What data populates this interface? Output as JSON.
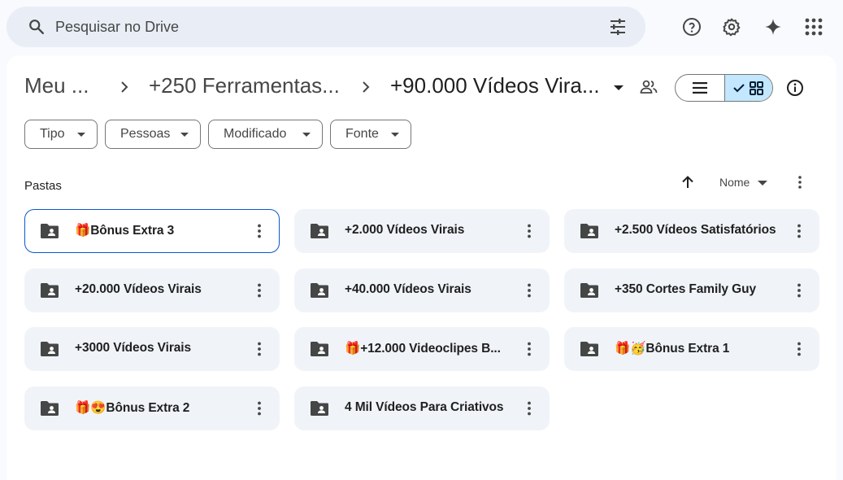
{
  "search": {
    "placeholder": "Pesquisar no Drive"
  },
  "header_icons": [
    "help-icon",
    "settings-icon",
    "gemini-sparkle-icon",
    "apps-grid-icon"
  ],
  "breadcrumb": {
    "items": [
      "Meu ...",
      "+250 Ferramentas...",
      "+90.000 Vídeos Vira..."
    ]
  },
  "filters": [
    "Tipo",
    "Pessoas",
    "Modificado",
    "Fonte"
  ],
  "section": {
    "label": "Pastas"
  },
  "sort": {
    "label": "Nome"
  },
  "view": {
    "selected": "grid"
  },
  "folders": [
    {
      "name": "🎁Bônus Extra 3",
      "selected": true
    },
    {
      "name": "+2.000 Vídeos Virais"
    },
    {
      "name": "+2.500 Vídeos Satisfatórios"
    },
    {
      "name": "+20.000 Vídeos Virais"
    },
    {
      "name": "+40.000 Vídeos Virais"
    },
    {
      "name": "+350 Cortes Family Guy"
    },
    {
      "name": "+3000 Vídeos Virais"
    },
    {
      "name": "🎁+12.000 Videoclipes B..."
    },
    {
      "name": "🎁🥳Bônus Extra 1"
    },
    {
      "name": "🎁😍Bônus Extra 2"
    },
    {
      "name": "4 Mil Vídeos Para Criativos"
    }
  ],
  "colors": {
    "accent": "#0b57d0",
    "selected_toggle": "#c2e7ff",
    "card_bg": "#f0f4f9",
    "search_bg": "#e9eef6"
  }
}
